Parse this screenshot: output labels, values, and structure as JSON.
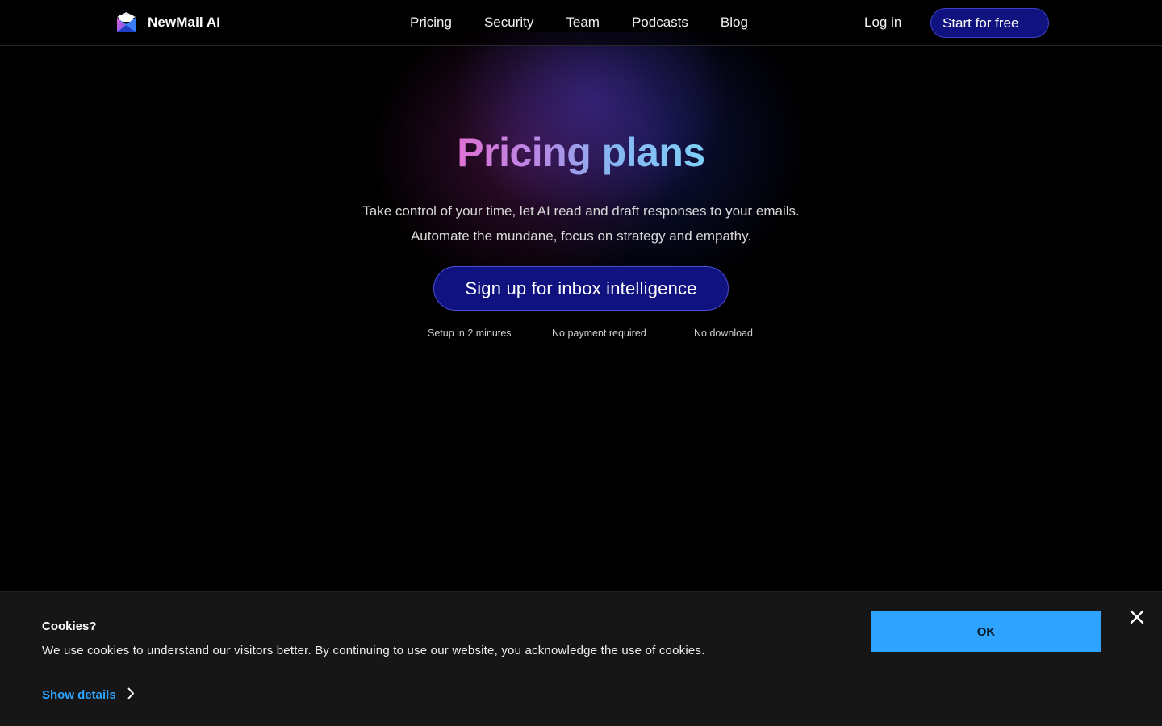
{
  "header": {
    "brand": "NewMail AI",
    "nav": [
      "Pricing",
      "Security",
      "Team",
      "Podcasts",
      "Blog"
    ],
    "login": "Log in",
    "start": "Start for free"
  },
  "hero": {
    "title": "Pricing plans",
    "subtitle_line1": "Take control of your time, let AI read and draft responses to your emails.",
    "subtitle_line2": "Automate the mundane, focus on strategy and empathy.",
    "cta": "Sign up for inbox intelligence",
    "perks": [
      "Setup in 2 minutes",
      "No payment required",
      "No download"
    ]
  },
  "cookie": {
    "title": "Cookies?",
    "text": "We use cookies to understand our visitors better. By continuing to use our website, you acknowledge the use of cookies.",
    "details": "Show details",
    "ok": "OK"
  },
  "colors": {
    "accent_button": "#10137f",
    "cookie_ok": "#2ea3ff",
    "details_link": "#2fa4ff"
  },
  "icons": {
    "logo": "envelope-logo-icon",
    "chevron": "chevron-right-icon",
    "close": "close-icon"
  }
}
